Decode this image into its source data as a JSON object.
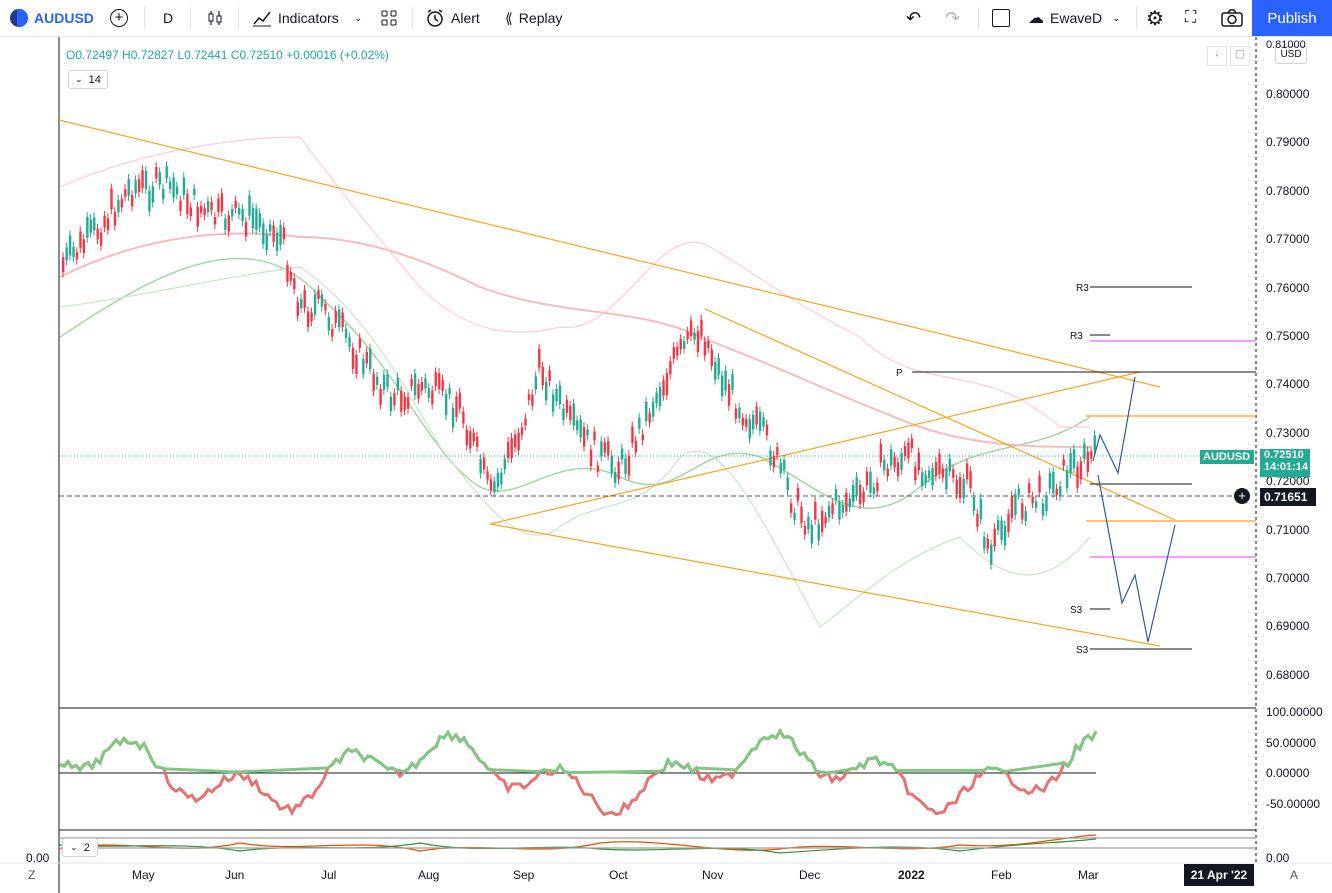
{
  "toolbar": {
    "symbol": "AUDUSD",
    "interval": "D",
    "indicators_label": "Indicators",
    "alert_label": "Alert",
    "replay_label": "Replay",
    "layout_name": "EwaveD",
    "publish_label": "Publish"
  },
  "legend": {
    "ohlc": "O0.72497 H0.72827 L0.72441 C0.72510 +0.00016 (+0.02%)",
    "period_badge": "14",
    "sub2_badge": "2"
  },
  "price_axis": {
    "currency": "USD",
    "top_label": "0.81000",
    "ticks": [
      "0.80000",
      "0.79000",
      "0.78000",
      "0.77000",
      "0.76000",
      "0.75000",
      "0.74000",
      "0.73000",
      "0.72000",
      "0.71000",
      "0.70000",
      "0.69000",
      "0.68000"
    ],
    "last_symbol": "AUDUSD",
    "last_price": "0.72510",
    "countdown": "14:01:14",
    "crosshair_price": "0.71651"
  },
  "osc_axis": {
    "ticks": [
      "100.00000",
      "50.00000",
      "0.00000",
      "-50.00000"
    ]
  },
  "sub2_axis": {
    "tick": "0.00",
    "left_label": "0.00"
  },
  "time_axis": {
    "labels": [
      "May",
      "Jun",
      "Jul",
      "Aug",
      "Sep",
      "Oct",
      "Nov",
      "Dec",
      "2022",
      "Feb",
      "Mar"
    ],
    "crosshair_date": "21 Apr '22",
    "left_btn": "Z",
    "right_btn": "A"
  },
  "pivots": {
    "r3_a": "R3",
    "r3_b": "R3",
    "p": "P",
    "s3_a": "S3",
    "s3_b": "S3"
  },
  "colors": {
    "up": "#22ab94",
    "down": "#f23645",
    "accent": "#2962ff",
    "trend": "#f7a525",
    "pink": "#e040fb"
  }
}
